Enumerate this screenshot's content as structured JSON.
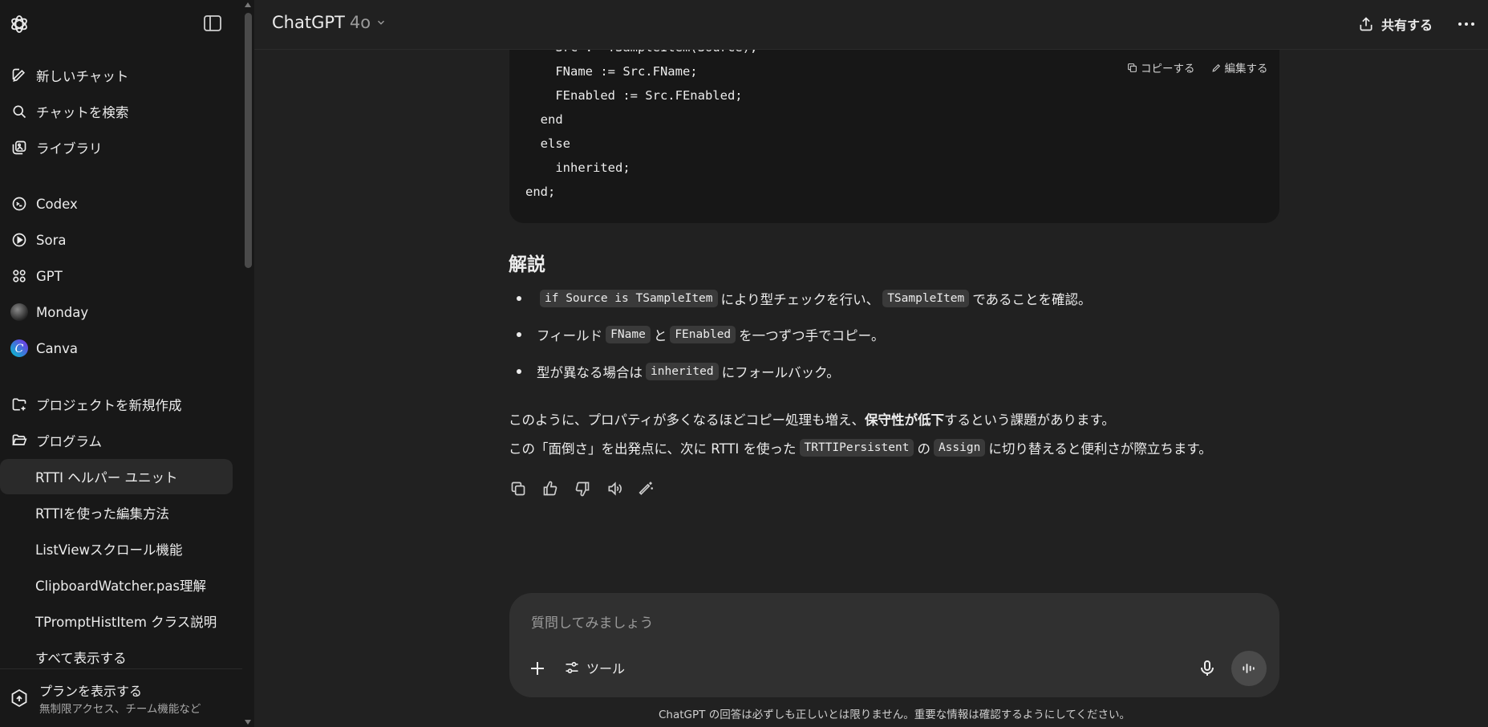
{
  "sidebar": {
    "top_items": [
      {
        "label": "新しいチャット",
        "icon": "new-chat-icon"
      },
      {
        "label": "チャットを検索",
        "icon": "search-icon"
      },
      {
        "label": "ライブラリ",
        "icon": "library-icon"
      }
    ],
    "apps": [
      {
        "label": "Codex",
        "icon": "codex-icon"
      },
      {
        "label": "Sora",
        "icon": "sora-icon"
      },
      {
        "label": "GPT",
        "icon": "gpt-grid-icon"
      },
      {
        "label": "Monday",
        "icon": "monday-avatar"
      },
      {
        "label": "Canva",
        "icon": "canva-icon"
      }
    ],
    "projects": [
      {
        "label": "プロジェクトを新規作成",
        "icon": "new-folder-icon"
      },
      {
        "label": "プログラム",
        "icon": "folder-open-icon"
      }
    ],
    "chats": [
      "RTTI ヘルパー ユニット",
      "RTTIを使った編集方法",
      "ListViewスクロール機能",
      "ClipboardWatcher.pas理解",
      "TPromptHistItem クラス説明",
      "すべて表示する"
    ],
    "plan": {
      "title": "プランを表示する",
      "subtitle": "無制限アクセス、チーム機能など"
    }
  },
  "header": {
    "model": "ChatGPT",
    "version": "4o",
    "share_label": "共有する"
  },
  "code": {
    "lines": [
      "    Src := TSampleItem(Source);",
      "    FName := Src.FName;",
      "    FEnabled := Src.FEnabled;",
      "  end",
      "  else",
      "    inherited;",
      "end;"
    ],
    "copy_label": "コピーする",
    "edit_label": "編集する"
  },
  "answer": {
    "section_title": "解説",
    "b1_code1": "if Source is TSampleItem",
    "b1_text1": "により型チェックを行い、",
    "b1_code2": "TSampleItem",
    "b1_text2": "であることを確認。",
    "b2_text1": "フィールド",
    "b2_code1": "FName",
    "b2_text2": "と",
    "b2_code2": "FEnabled",
    "b2_text3": "を一つずつ手でコピー。",
    "b3_text1": "型が異なる場合は",
    "b3_code1": "inherited",
    "b3_text2": "にフォールバック。",
    "p1_text1": "このように、プロパティが多くなるほどコピー処理も増え、",
    "p1_bold": "保守性が低下",
    "p1_text2": "するという課題があります。",
    "p2_text1": "この「面倒さ」を出発点に、次に RTTI を使った",
    "p2_code1": "TRTTIPersistent",
    "p2_text2": "の",
    "p2_code2": "Assign",
    "p2_text3": "に切り替えると便利さが際立ちます。"
  },
  "composer": {
    "placeholder": "質問してみましょう",
    "tools_label": "ツール"
  },
  "disclaimer": "ChatGPT の回答は必ずしも正しいとは限りません。重要な情報は確認するようにしてください。"
}
